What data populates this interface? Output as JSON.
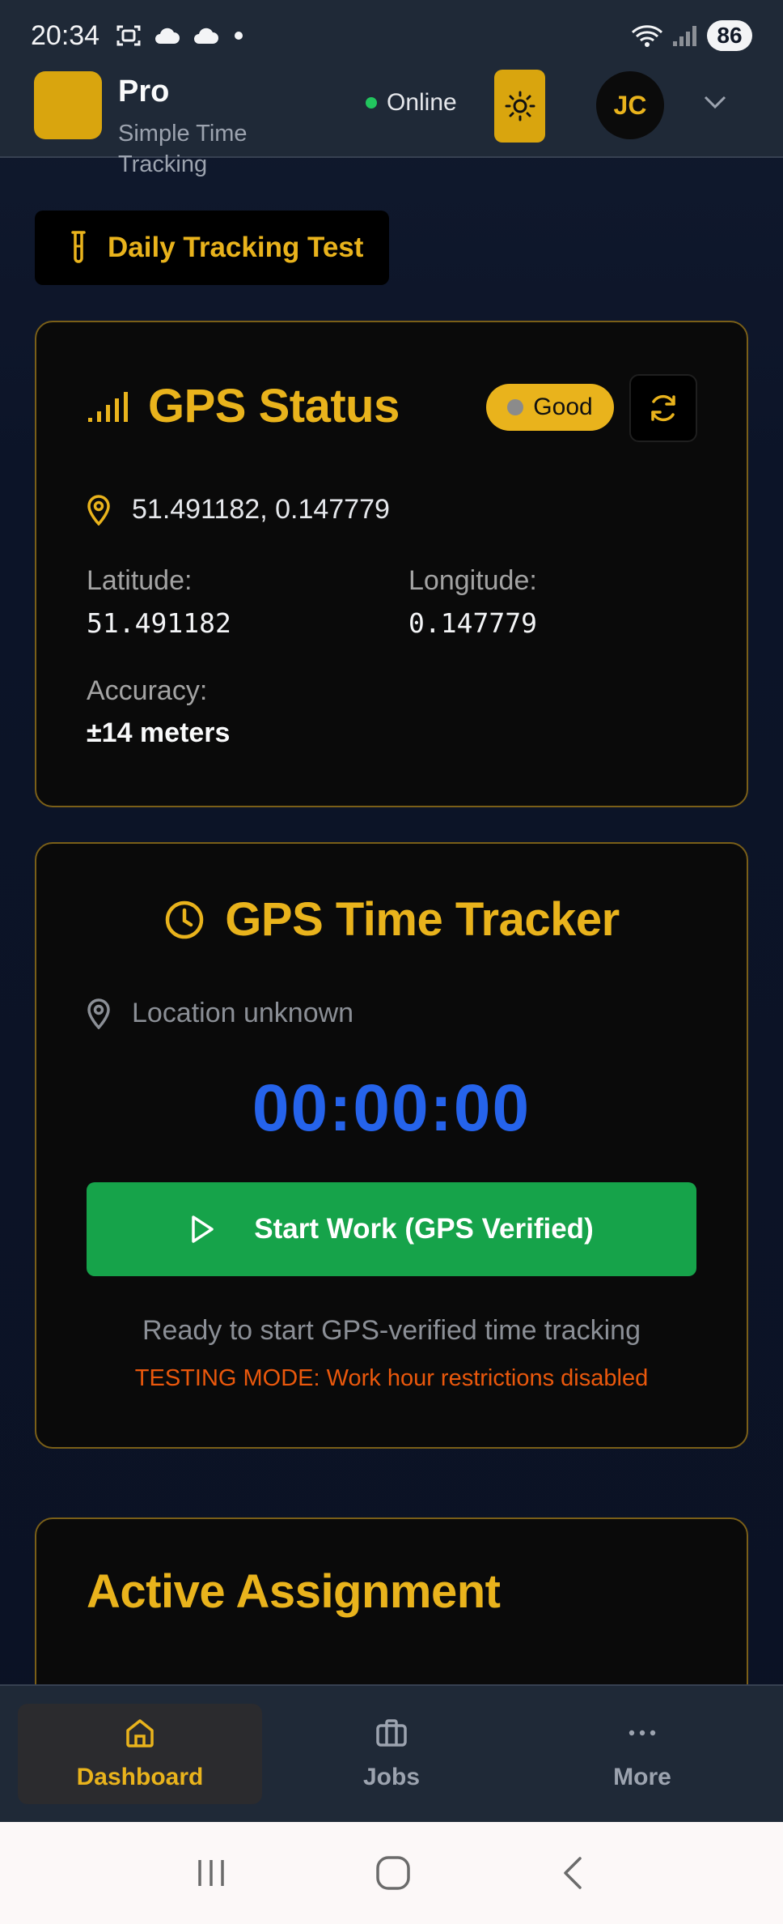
{
  "status_bar": {
    "time": "20:34",
    "battery": "86",
    "icons": [
      "screenshot-icon",
      "cloud-icon",
      "cloud-icon",
      "dot-icon",
      "wifi-icon",
      "signal-icon",
      "battery-icon"
    ]
  },
  "header": {
    "title": "Pro",
    "subtitle": "Simple Time Tracking",
    "status": "Online",
    "avatar_initials": "JC"
  },
  "test_button": {
    "label": "Daily Tracking Test"
  },
  "gps_status": {
    "title": "GPS Status",
    "badge": "Good",
    "coordinates": "51.491182, 0.147779",
    "latitude_label": "Latitude:",
    "latitude": "51.491182",
    "longitude_label": "Longitude:",
    "longitude": "0.147779",
    "accuracy_label": "Accuracy:",
    "accuracy": "±14 meters"
  },
  "tracker": {
    "title": "GPS Time Tracker",
    "location": "Location unknown",
    "hours": "00",
    "minutes": "00",
    "seconds": "00",
    "start_label": "Start Work (GPS Verified)",
    "ready_text": "Ready to start GPS-verified time tracking",
    "testing_text": "TESTING MODE: Work hour restrictions disabled"
  },
  "assignment": {
    "title": "Active Assignment"
  },
  "bottom_nav": {
    "items": [
      {
        "label": "Dashboard",
        "icon": "home-icon",
        "active": true
      },
      {
        "label": "Jobs",
        "icon": "briefcase-icon",
        "active": false
      },
      {
        "label": "More",
        "icon": "more-icon",
        "active": false
      }
    ]
  },
  "colors": {
    "accent": "#e9b31c",
    "background": "#0b1326",
    "card": "#0a0a0a",
    "timer": "#2563eb",
    "start": "#16a34a",
    "warning": "#ea580c",
    "online": "#22c55e"
  }
}
